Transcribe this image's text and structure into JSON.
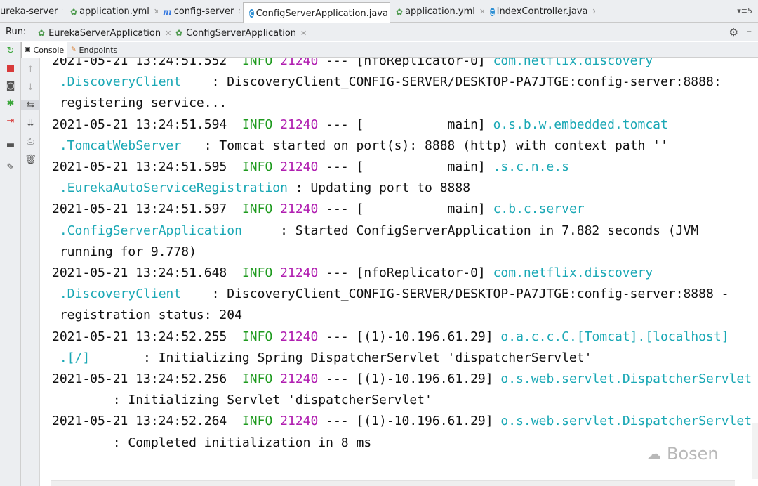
{
  "editor_tabs": [
    {
      "label": "ureka-server",
      "icon": "yml-icon"
    },
    {
      "label": "application.yml",
      "icon": "yml-icon"
    },
    {
      "label": "config-server",
      "icon": "maven-icon"
    },
    {
      "label": "ConfigServerApplication.java",
      "icon": "class-icon"
    },
    {
      "label": "application.yml",
      "icon": "yml-icon"
    },
    {
      "label": "IndexController.java",
      "icon": "class-icon"
    }
  ],
  "tab_overflow": "▾≡5",
  "run": {
    "label": "Run:",
    "tabs": [
      "EurekaServerApplication",
      "ConfigServerApplication"
    ]
  },
  "console_tabs": [
    "Console",
    "Endpoints"
  ],
  "log": [
    {
      "parts": [
        [
          "ts",
          "2021-05-21 13:24:51.552  "
        ],
        [
          "info",
          "INFO"
        ],
        [
          "plain",
          " "
        ],
        [
          "pid",
          "21240"
        ],
        [
          "plain",
          " --- [nfoReplicator-0] "
        ],
        [
          "cyan",
          "com.netflix.discovery"
        ]
      ]
    },
    {
      "parts": [
        [
          "cyan",
          " .DiscoveryClient"
        ],
        [
          "plain",
          "    : DiscoveryClient_CONFIG-SERVER/DESKTOP-PA7JTGE:config-server:8888:"
        ]
      ]
    },
    {
      "parts": [
        [
          "plain",
          " registering service..."
        ]
      ]
    },
    {
      "parts": [
        [
          "ts",
          "2021-05-21 13:24:51.594  "
        ],
        [
          "info",
          "INFO"
        ],
        [
          "plain",
          " "
        ],
        [
          "pid",
          "21240"
        ],
        [
          "plain",
          " --- [           main] "
        ],
        [
          "cyan",
          "o.s.b.w.embedded.tomcat"
        ]
      ]
    },
    {
      "parts": [
        [
          "cyan",
          " .TomcatWebServer"
        ],
        [
          "plain",
          "   : Tomcat started on port(s): 8888 (http) with context path ''"
        ]
      ]
    },
    {
      "parts": [
        [
          "ts",
          "2021-05-21 13:24:51.595  "
        ],
        [
          "info",
          "INFO"
        ],
        [
          "plain",
          " "
        ],
        [
          "pid",
          "21240"
        ],
        [
          "plain",
          " --- [           main] "
        ],
        [
          "cyan",
          ".s.c.n.e.s"
        ]
      ]
    },
    {
      "parts": [
        [
          "cyan",
          " .EurekaAutoServiceRegistration"
        ],
        [
          "plain",
          " : Updating port to 8888"
        ]
      ]
    },
    {
      "parts": [
        [
          "ts",
          "2021-05-21 13:24:51.597  "
        ],
        [
          "info",
          "INFO"
        ],
        [
          "plain",
          " "
        ],
        [
          "pid",
          "21240"
        ],
        [
          "plain",
          " --- [           main] "
        ],
        [
          "cyan",
          "c.b.c.server"
        ]
      ]
    },
    {
      "parts": [
        [
          "cyan",
          " .ConfigServerApplication"
        ],
        [
          "plain",
          "     : Started ConfigServerApplication in 7.882 seconds (JVM"
        ]
      ]
    },
    {
      "parts": [
        [
          "plain",
          " running for 9.778)"
        ]
      ]
    },
    {
      "parts": [
        [
          "ts",
          "2021-05-21 13:24:51.648  "
        ],
        [
          "info",
          "INFO"
        ],
        [
          "plain",
          " "
        ],
        [
          "pid",
          "21240"
        ],
        [
          "plain",
          " --- [nfoReplicator-0] "
        ],
        [
          "cyan",
          "com.netflix.discovery"
        ]
      ]
    },
    {
      "parts": [
        [
          "cyan",
          " .DiscoveryClient"
        ],
        [
          "plain",
          "    : DiscoveryClient_CONFIG-SERVER/DESKTOP-PA7JTGE:config-server:8888 -"
        ]
      ]
    },
    {
      "parts": [
        [
          "plain",
          " registration status: 204"
        ]
      ]
    },
    {
      "parts": [
        [
          "ts",
          "2021-05-21 13:24:52.255  "
        ],
        [
          "info",
          "INFO"
        ],
        [
          "plain",
          " "
        ],
        [
          "pid",
          "21240"
        ],
        [
          "plain",
          " --- [(1)-10.196.61.29] "
        ],
        [
          "cyan",
          "o.a.c.c.C.[Tomcat].[localhost]"
        ]
      ]
    },
    {
      "parts": [
        [
          "cyan",
          " .[/]"
        ],
        [
          "plain",
          "       : Initializing Spring DispatcherServlet 'dispatcherServlet'"
        ]
      ]
    },
    {
      "parts": [
        [
          "ts",
          "2021-05-21 13:24:52.256  "
        ],
        [
          "info",
          "INFO"
        ],
        [
          "plain",
          " "
        ],
        [
          "pid",
          "21240"
        ],
        [
          "plain",
          " --- [(1)-10.196.61.29] "
        ],
        [
          "cyan",
          "o.s.web.servlet.DispatcherServlet"
        ]
      ]
    },
    {
      "parts": [
        [
          "plain",
          "        : Initializing Servlet 'dispatcherServlet'"
        ]
      ]
    },
    {
      "parts": [
        [
          "ts",
          "2021-05-21 13:24:52.264  "
        ],
        [
          "info",
          "INFO"
        ],
        [
          "plain",
          " "
        ],
        [
          "pid",
          "21240"
        ],
        [
          "plain",
          " --- [(1)-10.196.61.29] "
        ],
        [
          "cyan",
          "o.s.web.servlet.DispatcherServlet"
        ]
      ]
    },
    {
      "parts": [
        [
          "plain",
          "        : Completed initialization in 8 ms"
        ]
      ]
    }
  ],
  "watermark": "Bosen",
  "colors": {
    "info": "#1e9a1e",
    "pid": "#b01eb0",
    "logger": "#1aa8b5"
  }
}
